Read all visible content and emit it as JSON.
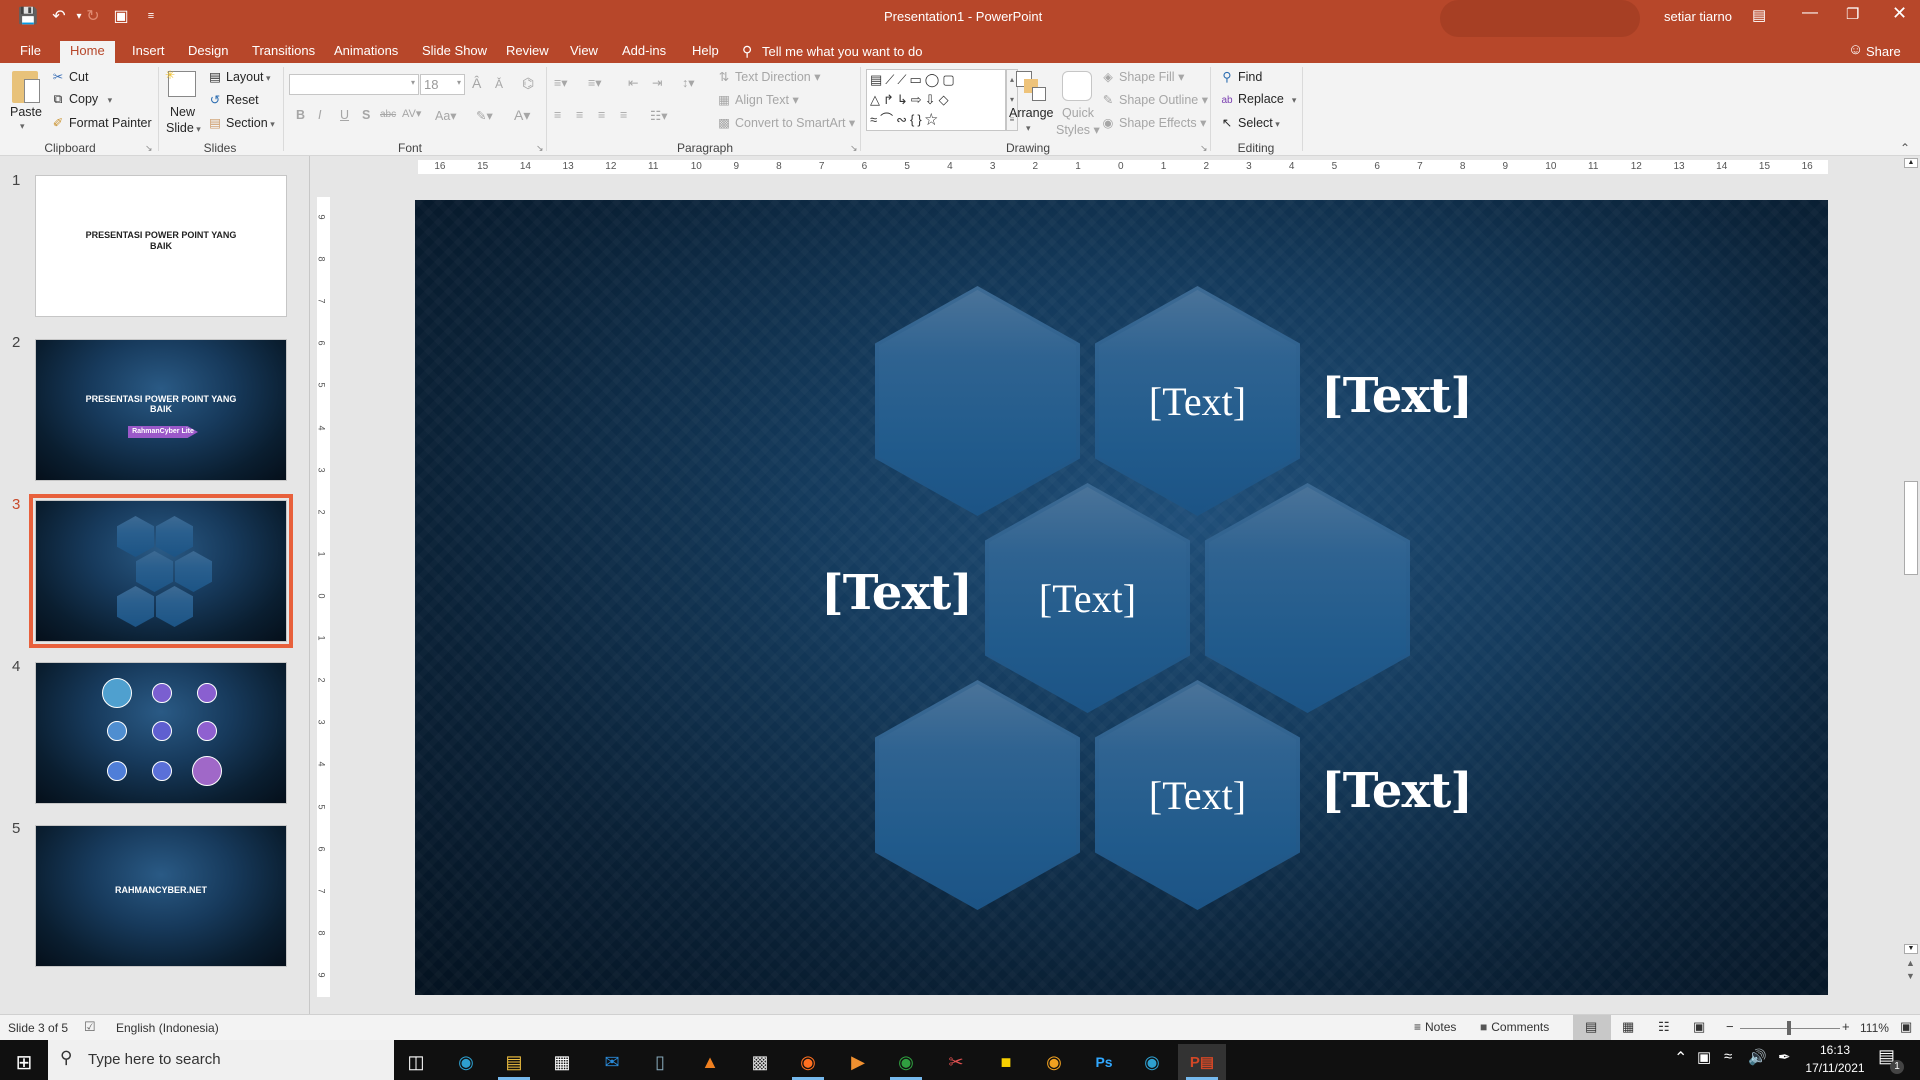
{
  "window": {
    "title": "Presentation1  -  PowerPoint",
    "user": "setiar tiarno",
    "share_label": "Share",
    "tell_me": "Tell me what you want to do"
  },
  "qat": {
    "save_icon": "save-icon",
    "undo_icon": "undo-icon",
    "redo_icon": "redo-icon",
    "present_icon": "present-from-start-icon",
    "customize_icon": "customize-qat-icon"
  },
  "tabs": [
    {
      "label": "File"
    },
    {
      "label": "Home",
      "active": true
    },
    {
      "label": "Insert"
    },
    {
      "label": "Design"
    },
    {
      "label": "Transitions"
    },
    {
      "label": "Animations"
    },
    {
      "label": "Slide Show"
    },
    {
      "label": "Review"
    },
    {
      "label": "View"
    },
    {
      "label": "Add-ins"
    },
    {
      "label": "Help"
    }
  ],
  "ribbon": {
    "clipboard": {
      "group": "Clipboard",
      "paste": "Paste",
      "cut": "Cut",
      "copy": "Copy",
      "format_painter": "Format Painter"
    },
    "slides": {
      "group": "Slides",
      "new_slide_1": "New",
      "new_slide_2": "Slide",
      "layout": "Layout",
      "reset": "Reset",
      "section": "Section"
    },
    "font": {
      "group": "Font",
      "font_name": "",
      "font_size": "18"
    },
    "paragraph": {
      "group": "Paragraph",
      "text_direction": "Text Direction",
      "align_text": "Align Text",
      "convert_smartart": "Convert to SmartArt"
    },
    "drawing": {
      "group": "Drawing",
      "arrange": "Arrange",
      "quick_styles_1": "Quick",
      "quick_styles_2": "Styles",
      "shape_fill": "Shape Fill",
      "shape_outline": "Shape Outline",
      "shape_effects": "Shape Effects"
    },
    "editing": {
      "group": "Editing",
      "find": "Find",
      "replace": "Replace",
      "select": "Select"
    }
  },
  "thumbnails": [
    {
      "num": "1",
      "title_1": "PRESENTASI POWER POINT YANG",
      "title_2": "BAIK",
      "style": "white"
    },
    {
      "num": "2",
      "title_1": "PRESENTASI POWER POINT YANG",
      "title_2": "BAIK",
      "badge": "RahmanCyber Lite",
      "style": "dark"
    },
    {
      "num": "3",
      "style": "dark",
      "selected": true
    },
    {
      "num": "4",
      "style": "dark"
    },
    {
      "num": "5",
      "title_1": "RAHMANCYBER.NET",
      "style": "dark"
    }
  ],
  "ruler": {
    "horizontal": [
      "16",
      "15",
      "14",
      "13",
      "12",
      "11",
      "10",
      "9",
      "8",
      "7",
      "6",
      "5",
      "4",
      "3",
      "2",
      "1",
      "0",
      "1",
      "2",
      "3",
      "4",
      "5",
      "6",
      "7",
      "8",
      "9",
      "10",
      "11",
      "12",
      "13",
      "14",
      "15",
      "16"
    ],
    "vertical": [
      "9",
      "8",
      "7",
      "6",
      "5",
      "4",
      "3",
      "2",
      "1",
      "0",
      "1",
      "2",
      "3",
      "4",
      "5",
      "6",
      "7",
      "8",
      "9"
    ]
  },
  "slide": {
    "placeholder_in_hex": "[Text]",
    "labels": [
      "[Text]",
      "[Text]",
      "[Text]",
      "[Text]",
      "[Text]",
      "[Text]"
    ]
  },
  "status": {
    "slide_info": "Slide 3 of 5",
    "language": "English (Indonesia)",
    "notes": "Notes",
    "comments": "Comments",
    "zoom": "111%"
  },
  "taskbar": {
    "search_placeholder": "Type here to search",
    "time": "16:13",
    "date": "17/11/2021",
    "notification_count": "1"
  }
}
